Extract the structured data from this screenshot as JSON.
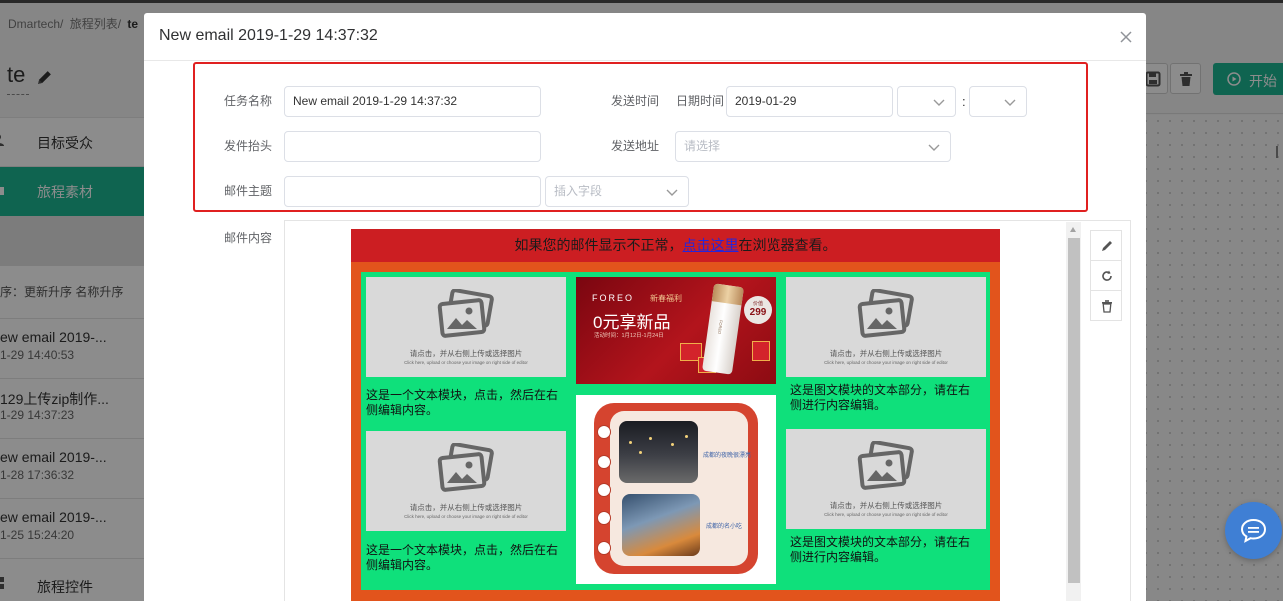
{
  "app": {
    "breadcrumb": [
      "Dmartech/",
      "旅程列表/",
      "te"
    ],
    "journey_title": "te",
    "nav": [
      {
        "label": "目标受众",
        "icon": "users-icon"
      },
      {
        "label": "旅程素材",
        "icon": "folder-icon",
        "active": true
      }
    ],
    "sort_text": "序：更新升序 名称升序",
    "materials": [
      {
        "name": "ew email 2019-...",
        "time": "1-29 14:40:53"
      },
      {
        "name": "129上传zip制作...",
        "time": "1-29 14:37:23"
      },
      {
        "name": "ew email 2019-...",
        "time": "1-28 17:36:32"
      },
      {
        "name": "ew email 2019-...",
        "time": "1-25 15:24:20"
      }
    ],
    "controls_label": "旅程控件",
    "toolbar": {
      "start_label": "开始",
      "icons": [
        "save-icon",
        "trash-icon",
        "play-circle-icon"
      ]
    }
  },
  "modal": {
    "title": "New email 2019-1-29 14:37:32",
    "close_icon": "close-icon",
    "form": {
      "task_name_label": "任务名称",
      "task_name_value": "New email 2019-1-29 14:37:32",
      "send_time_label": "发送时间",
      "datetime_label": "日期时间",
      "date_value": "2019-01-29",
      "hour_value": "",
      "time_separator": ":",
      "minute_value": "",
      "sender_label": "发件抬头",
      "sender_value": "",
      "address_label": "发送地址",
      "address_placeholder": "请选择",
      "subject_label": "邮件主题",
      "subject_value": "",
      "insert_field_placeholder": "插入字段",
      "content_label": "邮件内容"
    },
    "editor_tools": [
      "pencil-icon",
      "refresh-icon",
      "trash-icon"
    ],
    "email": {
      "notice_prefix": "如果您的邮件显示不正常，",
      "notice_link": "点击这里",
      "notice_suffix": "在浏览器查看。",
      "placeholder_cn": "请点击，并从右侧上传或选择图片",
      "placeholder_en": "Click here, upload or choose your image on right side of editor",
      "text_block_left": "这是一个文本模块，点击，然后在右侧编辑内容。",
      "text_block_right": "这是图文模块的文本部分，请在右侧进行内容编辑。",
      "banner": {
        "brand": "FOREO",
        "tag": "新春福利",
        "headline": "0元享新品",
        "period": "活动时间：1月12日-1月24日",
        "price_label": "价值",
        "price": "299"
      },
      "notebook": {
        "caption1": "成都的夜晚很漂亮",
        "caption2": "成都的名小吃"
      }
    }
  },
  "colors": {
    "accent_green": "#1db793",
    "highlight_red": "#e02020",
    "notice_red": "#cc1e22",
    "email_orange": "#e2541c",
    "email_green": "#0fe07b",
    "chat_blue": "#3f7fd4"
  }
}
